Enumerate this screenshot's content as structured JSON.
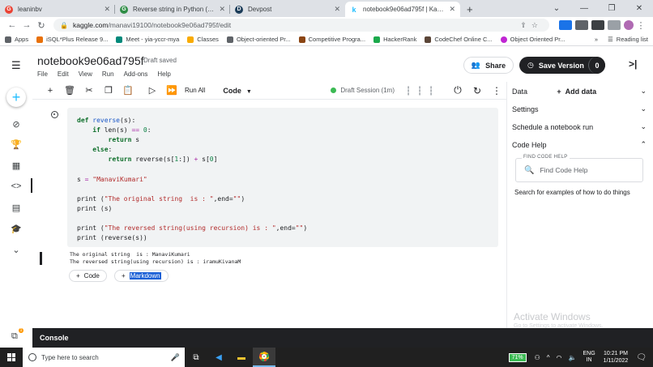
{
  "browser": {
    "tabs": [
      {
        "label": "leaninbv",
        "color": "#ea4335",
        "glyph": "G",
        "active": false
      },
      {
        "label": "Reverse string in Python (5 differ",
        "color": "#2f8d46",
        "glyph": "G",
        "active": false
      },
      {
        "label": "Devpost",
        "color": "#1c3d5a",
        "glyph": "D",
        "active": false
      },
      {
        "label": "notebook9e06ad795f | Kaggle",
        "color": "#20beff",
        "glyph": "k",
        "active": true
      }
    ],
    "url_host": "kaggle.com",
    "url_path": "/manavi19100/notebook9e06ad795f/edit",
    "bookmarks": [
      {
        "label": "Apps",
        "color": "#5f6368"
      },
      {
        "label": "iSQL*Plus Release 9...",
        "color": "#e8710a"
      },
      {
        "label": "Meet - yia-yccr-mya",
        "color": "#00897b"
      },
      {
        "label": "Classes",
        "color": "#f9ab00"
      },
      {
        "label": "Object-oriented Pr...",
        "color": "#5f6368"
      },
      {
        "label": "Competitive Progra...",
        "color": "#8b4513"
      },
      {
        "label": "HackerRank",
        "color": "#1ba94c"
      },
      {
        "label": "CodeChef Online C...",
        "color": "#5b4638"
      },
      {
        "label": "Object Oriented Pr...",
        "color": "#c026d3"
      }
    ],
    "reading_list": "Reading list"
  },
  "header": {
    "title": "notebook9e06ad795f",
    "status": "Draft saved",
    "menu": [
      "File",
      "Edit",
      "View",
      "Run",
      "Add-ons",
      "Help"
    ],
    "share_label": "Share",
    "save_label": "Save Version",
    "save_count": "0"
  },
  "toolbar": {
    "run_all": "Run All",
    "cell_type": "Code",
    "session": "Draft Session (1m)"
  },
  "code_lines": [
    "def reverse(s):",
    "    if len(s) == 0:",
    "        return s",
    "    else:",
    "        return reverse(s[1:]) + s[0]",
    "",
    "s = \"ManaviKumari\"",
    "",
    "print (\"The original string  is : \",end=\"\")",
    "print (s)",
    "",
    "print (\"The reversed string(using recursion) is : \",end=\"\")",
    "print (reverse(s))"
  ],
  "output_lines": [
    "The original string  is : ManaviKumari",
    "The reversed string(using recursion) is : iramuKivanaM"
  ],
  "add_cell": {
    "code": "Code",
    "markdown": "Markdown"
  },
  "right_panel": {
    "data": "Data",
    "add_data": "Add data",
    "settings": "Settings",
    "schedule": "Schedule a notebook run",
    "code_help": "Code Help",
    "find_label": "FIND CODE HELP",
    "find_placeholder": "Find Code Help",
    "hint": "Search for examples of how to do things",
    "activate_title": "Activate Windows",
    "activate_sub": "Go to Settings to activate Windows."
  },
  "console": {
    "label": "Console"
  },
  "taskbar": {
    "search_placeholder": "Type here to search",
    "battery": "71%",
    "lang_1": "ENG",
    "lang_2": "IN",
    "time": "10:21 PM",
    "date": "1/11/2022"
  },
  "colors": {
    "kaggle_blue": "#20beff",
    "session_green": "#3cba54",
    "dark": "#202124"
  }
}
